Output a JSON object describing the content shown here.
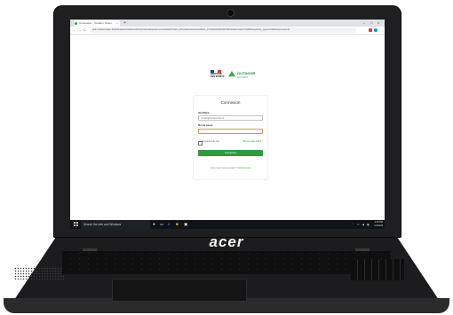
{
  "browser": {
    "tab_title": "Connexion · Outdoor Vision",
    "new_tab_symbol": "+",
    "window_controls": [
      "–",
      "□",
      "×"
    ],
    "nav_icons": [
      "←",
      "→",
      "C"
    ],
    "url": "auth.outdoorvision.fr/auth/realms/OutdoorVision/protocol/openid-connect/auth?client_id=outdoorvision&redirect_uri=https%3A%2F%2Foutdoorvision.fr%2F&response_type=code&scope=openid",
    "tab_close": "×"
  },
  "logos": {
    "government_text": "MINISTÈRE DES SPORTS",
    "brand_name": "OUTDOOR",
    "brand_sub": "VISION"
  },
  "login": {
    "title": "Connexion",
    "identifier_label": "Identifiant",
    "identifier_value": "contact@outdoorvision.fr",
    "password_label": "Mot de passe",
    "password_value": "",
    "remember_label": "Se souvenir de moi",
    "forgot_link": "Mot de passe oublié ?",
    "submit_label": "Connexion",
    "signup_text": "Vous n'avez pas de compte ?",
    "signup_link": "Inscrivez-vous"
  },
  "taskbar": {
    "search_placeholder": "Search the web and Windows",
    "tray_icons": "⌃ ▭ ◀ ▦",
    "time": "2:15 PM",
    "date": "1/1/2019"
  },
  "laptop": {
    "brand": "acer"
  },
  "colors": {
    "accent_green": "#2f9b3f",
    "taskbar": "#0f1216",
    "bezel": "#1f1f22"
  }
}
